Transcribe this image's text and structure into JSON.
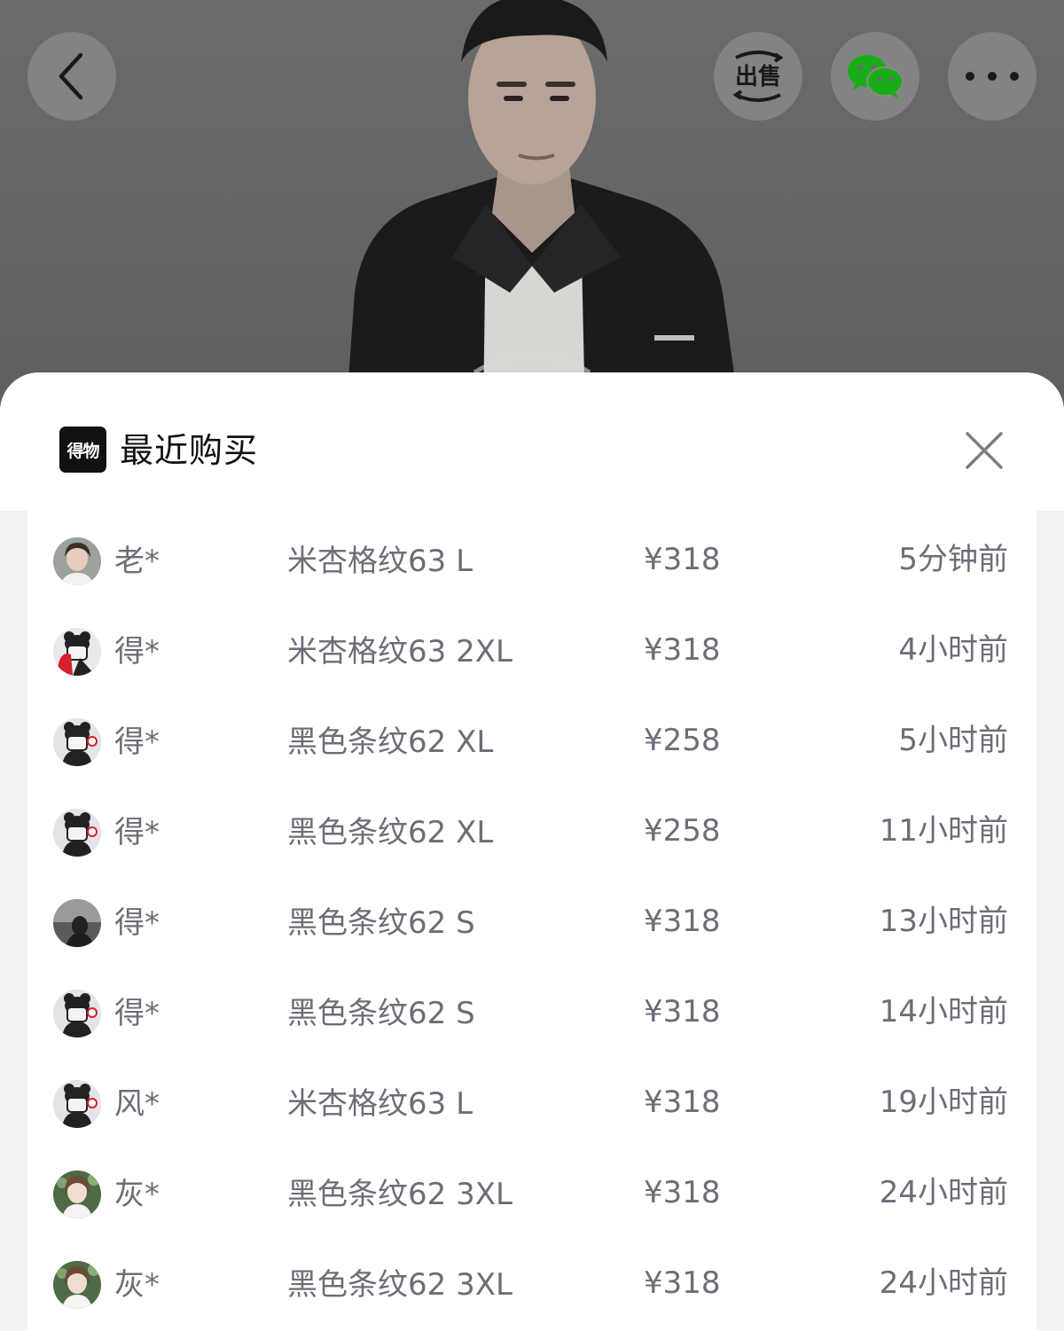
{
  "top_bar": {
    "back_icon": "chevron-left-icon",
    "sell_label": "出售",
    "wechat_icon": "wechat-icon",
    "more_icon": "more-dots-icon"
  },
  "sheet": {
    "brand_logo": "得物",
    "title": "最近购买",
    "close_icon": "close-icon"
  },
  "purchases": [
    {
      "avatar": "avatar-photo-woman",
      "buyer": "老*",
      "item": "米杏格纹63 L",
      "price": "¥318",
      "time": "5分钟前"
    },
    {
      "avatar": "avatar-cartoon-bear-red",
      "buyer": "得*",
      "item": "米杏格纹63 2XL",
      "price": "¥318",
      "time": "4小时前"
    },
    {
      "avatar": "avatar-cartoon-bear",
      "buyer": "得*",
      "item": "黑色条纹62 XL",
      "price": "¥258",
      "time": "5小时前"
    },
    {
      "avatar": "avatar-cartoon-bear",
      "buyer": "得*",
      "item": "黑色条纹62 XL",
      "price": "¥258",
      "time": "11小时前"
    },
    {
      "avatar": "avatar-photo-dark",
      "buyer": "得*",
      "item": "黑色条纹62 S",
      "price": "¥318",
      "time": "13小时前"
    },
    {
      "avatar": "avatar-cartoon-bear",
      "buyer": "得*",
      "item": "黑色条纹62 S",
      "price": "¥318",
      "time": "14小时前"
    },
    {
      "avatar": "avatar-cartoon-bear",
      "buyer": "风*",
      "item": "米杏格纹63 L",
      "price": "¥318",
      "time": "19小时前"
    },
    {
      "avatar": "avatar-photo-girl",
      "buyer": "灰*",
      "item": "黑色条纹62 3XL",
      "price": "¥318",
      "time": "24小时前"
    },
    {
      "avatar": "avatar-photo-girl",
      "buyer": "灰*",
      "item": "黑色条纹62 3XL",
      "price": "¥318",
      "time": "24小时前"
    }
  ],
  "colors": {
    "overlay": "#6b6b6b",
    "text_secondary": "#6d6d78",
    "wechat_green": "#1aad19",
    "logo_black": "#111111"
  }
}
